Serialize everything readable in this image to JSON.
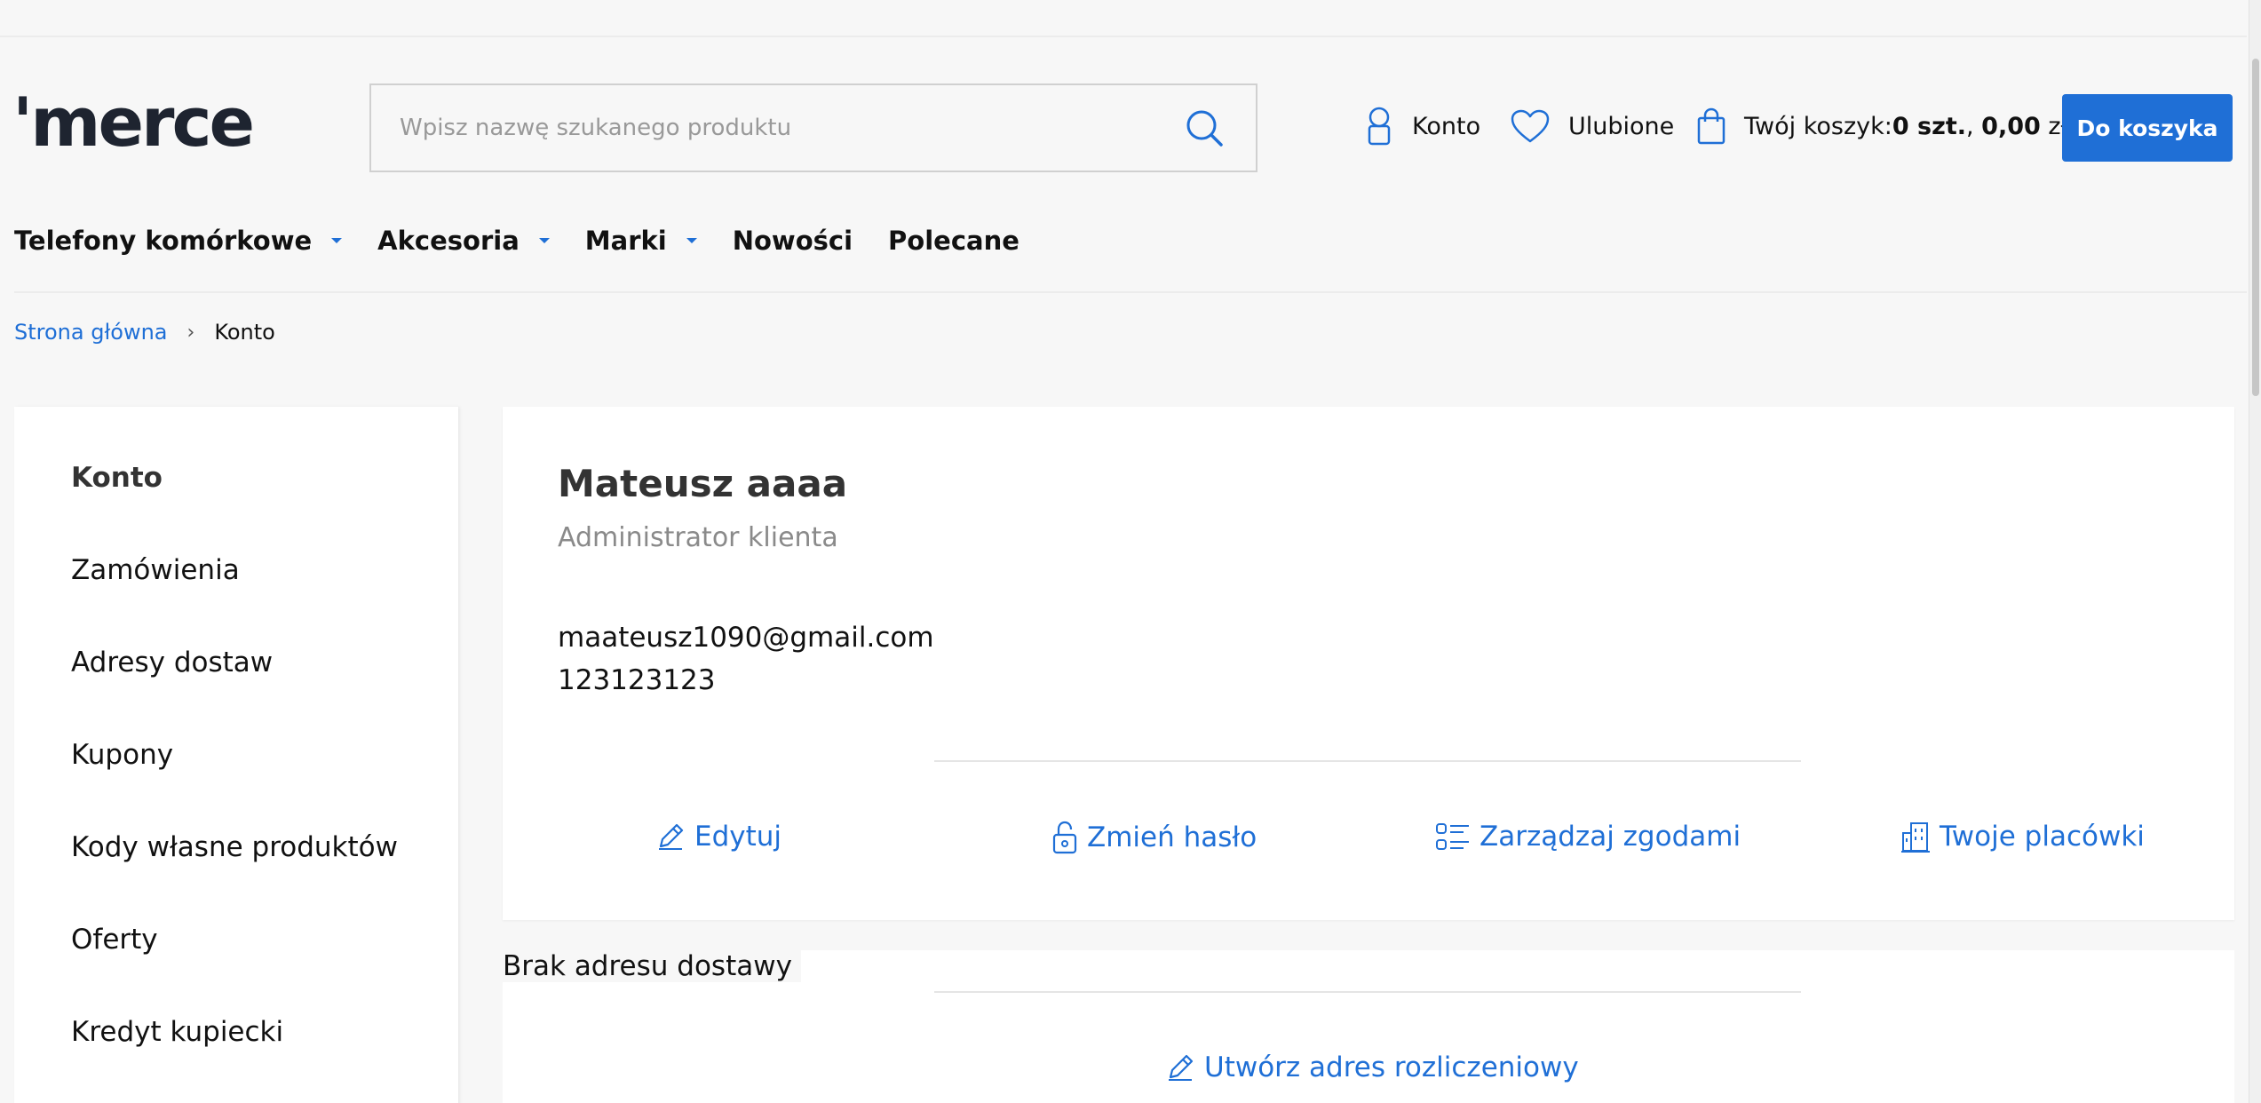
{
  "header": {
    "logo": "'merce",
    "search_placeholder": "Wpisz nazwę szukanego produktu",
    "account_label": "Konto",
    "favorites_label": "Ulubione",
    "cart_prefix": "Twój koszyk:",
    "cart_count": "0 szt.",
    "cart_sep": ", ",
    "cart_total": "0,00",
    "cart_currency": " zł",
    "cart_button": "Do koszyka"
  },
  "nav": {
    "items": [
      "Telefony komórkowe",
      "Akcesoria",
      "Marki",
      "Nowości",
      "Polecane"
    ]
  },
  "breadcrumb": {
    "home": "Strona główna",
    "separator": "›",
    "current": "Konto"
  },
  "sidebar": {
    "items": [
      "Konto",
      "Zamówienia",
      "Adresy dostaw",
      "Kupony",
      "Kody własne produktów",
      "Oferty",
      "Kredyt kupiecki"
    ]
  },
  "profile": {
    "name": "Mateusz aaaa",
    "role": "Administrator klienta",
    "email": "maateusz1090@gmail.com",
    "phone": "123123123",
    "actions": {
      "edit": "Edytuj",
      "change_password": "Zmień hasło",
      "manage_consents": "Zarządzaj zgodami",
      "your_branches": "Twoje placówki"
    }
  },
  "address": {
    "empty_text": "Brak adresu dostawy",
    "create_billing": "Utwórz adres rozliczeniowy"
  },
  "colors": {
    "accent": "#1f6fd6",
    "text": "#111111",
    "muted": "#8a8a8a",
    "background": "#f7f7f7"
  }
}
